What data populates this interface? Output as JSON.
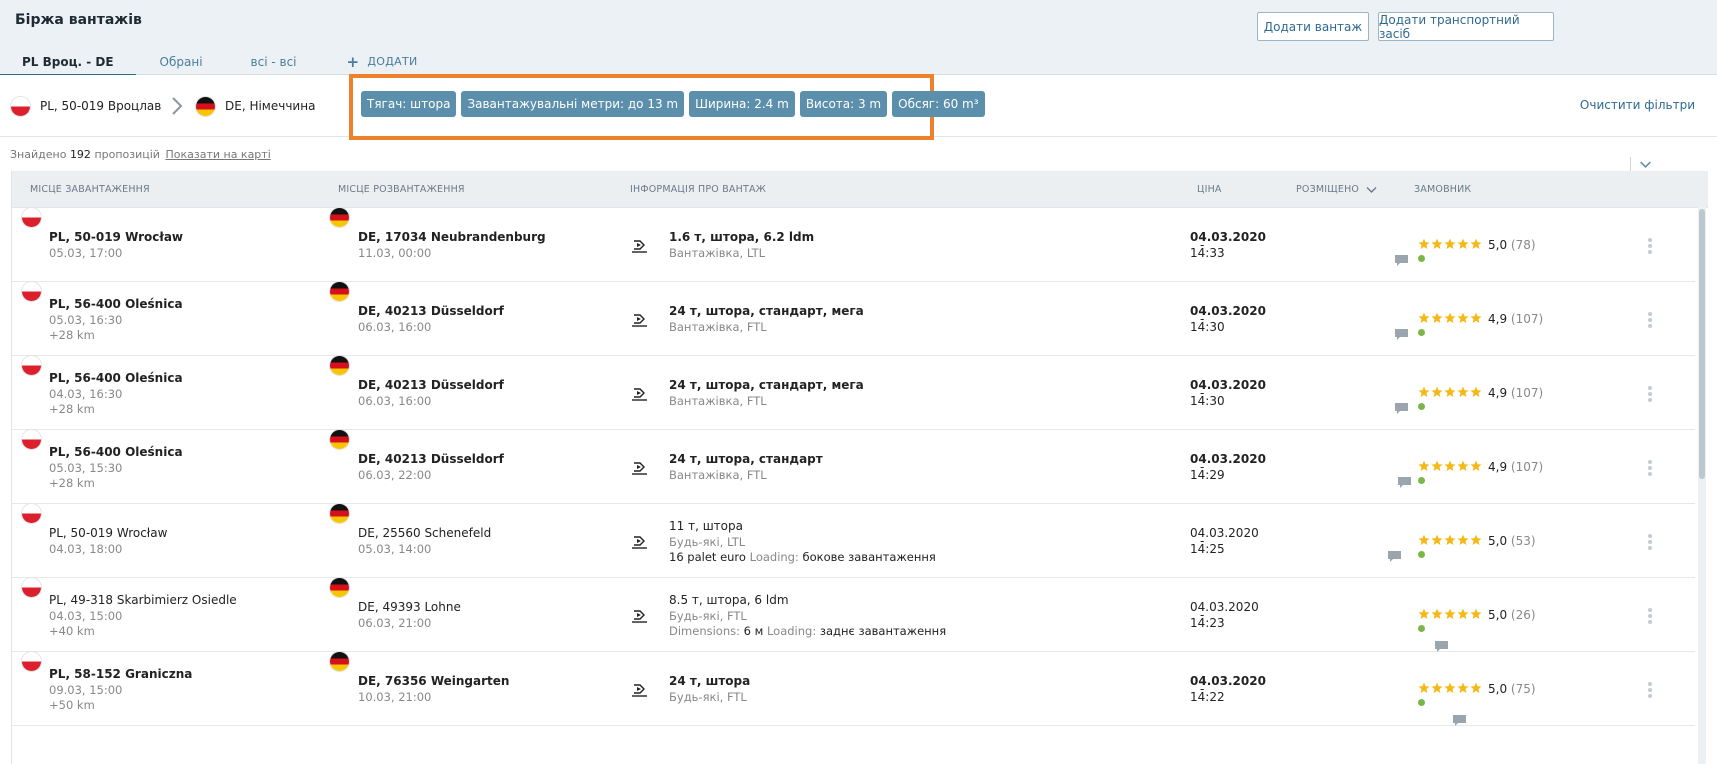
{
  "header": {
    "title": "Біржа вантажів",
    "add_freight_label": "Додати вантаж",
    "add_vehicle_label": "Додати транспортний засіб"
  },
  "tabs": [
    {
      "label": "PL Вроц. - DE",
      "active": true
    },
    {
      "label": "Обрані",
      "active": false
    },
    {
      "label": "всі - всі",
      "active": false
    }
  ],
  "add_tab_label": "ДОДАТИ",
  "filters": {
    "origin": "PL, 50-019 Вроцлав",
    "destination": "DE, Німеччина",
    "chips": [
      "Тягач: штора",
      "Завантажувальні метри: до 13 m",
      "Ширина: 2.4 m",
      "Висота: 3 m",
      "Обсяг: 60 m³"
    ],
    "clear_label": "Очистити фільтри"
  },
  "results": {
    "found_prefix": "Знайдено",
    "count": "192",
    "found_suffix": "пропозицій",
    "map_link": "Показати на карті"
  },
  "columns": {
    "loading": "МІСЦЕ ЗАВАНТАЖЕННЯ",
    "unloading": "МІСЦЕ РОЗВАНТАЖЕННЯ",
    "cargo": "ІНФОРМАЦІЯ ПРО ВАНТАЖ",
    "price": "ЦІНА",
    "posted": "РОЗМІЩЕНО",
    "customer": "ЗАМОВНИК"
  },
  "rows": [
    {
      "from_place": "PL, 50-019 Wrocław",
      "from_date": "05.03, 17:00",
      "from_extra": "",
      "to_place": "DE, 17034 Neubrandenburg",
      "to_date": "11.03, 00:00",
      "cargo_main": "1.6 т, штора, 6.2 ldm",
      "cargo_type": "Вантажівка, LTL",
      "cargo_extra_label": "",
      "cargo_extra": "",
      "cargo_extra_label2": "",
      "cargo_extra2": "",
      "price": "-",
      "posted_date": "04.03.2020",
      "posted_time": "14:33",
      "rating": "5,0",
      "reviews": "(78)",
      "bold": true
    },
    {
      "from_place": "PL, 56-400 Oleśnica",
      "from_date": "05.03, 16:30",
      "from_extra": "+28 km",
      "to_place": "DE, 40213 Düsseldorf",
      "to_date": "06.03, 16:00",
      "cargo_main": "24 т, штора, стандарт, мега",
      "cargo_type": "Вантажівка, FTL",
      "cargo_extra_label": "",
      "cargo_extra": "",
      "cargo_extra_label2": "",
      "cargo_extra2": "",
      "price": "-",
      "posted_date": "04.03.2020",
      "posted_time": "14:30",
      "rating": "4,9",
      "reviews": "(107)",
      "bold": true
    },
    {
      "from_place": "PL, 56-400 Oleśnica",
      "from_date": "04.03, 16:30",
      "from_extra": "+28 km",
      "to_place": "DE, 40213 Düsseldorf",
      "to_date": "06.03, 16:00",
      "cargo_main": "24 т, штора, стандарт, мега",
      "cargo_type": "Вантажівка, FTL",
      "cargo_extra_label": "",
      "cargo_extra": "",
      "cargo_extra_label2": "",
      "cargo_extra2": "",
      "price": "-",
      "posted_date": "04.03.2020",
      "posted_time": "14:30",
      "rating": "4,9",
      "reviews": "(107)",
      "bold": true
    },
    {
      "from_place": "PL, 56-400 Oleśnica",
      "from_date": "05.03, 15:30",
      "from_extra": "+28 km",
      "to_place": "DE, 40213 Düsseldorf",
      "to_date": "06.03, 22:00",
      "cargo_main": "24 т, штора, стандарт",
      "cargo_type": "Вантажівка, FTL",
      "cargo_extra_label": "",
      "cargo_extra": "",
      "cargo_extra_label2": "",
      "cargo_extra2": "",
      "price": "-",
      "posted_date": "04.03.2020",
      "posted_time": "14:29",
      "rating": "4,9",
      "reviews": "(107)",
      "bold": true
    },
    {
      "from_place": "PL, 50-019 Wrocław",
      "from_date": "04.03, 18:00",
      "from_extra": "",
      "to_place": "DE, 25560 Schenefeld",
      "to_date": "05.03, 14:00",
      "cargo_main": "11 т, штора",
      "cargo_type": "Будь-які, LTL",
      "cargo_extra_label": "16 palet euro",
      "cargo_extra": "",
      "cargo_extra_label2": "Loading:",
      "cargo_extra2": "бокове завантаження",
      "price": "-",
      "posted_date": "04.03.2020",
      "posted_time": "14:25",
      "rating": "5,0",
      "reviews": "(53)",
      "bold": false
    },
    {
      "from_place": "PL, 49-318 Skarbimierz Osiedle",
      "from_date": "04.03, 15:00",
      "from_extra": "+40 km",
      "to_place": "DE, 49393 Lohne",
      "to_date": "06.03, 21:00",
      "cargo_main": "8.5 т, штора, 6 ldm",
      "cargo_type": "Будь-які, FTL",
      "cargo_extra_label": "Dimensions:",
      "cargo_extra": "6 м",
      "cargo_extra_label2": "Loading:",
      "cargo_extra2": "заднє завантаження",
      "price": "-",
      "posted_date": "04.03.2020",
      "posted_time": "14:23",
      "rating": "5,0",
      "reviews": "(26)",
      "bold": false
    },
    {
      "from_place": "PL, 58-152 Graniczna",
      "from_date": "09.03, 15:00",
      "from_extra": "+50 km",
      "to_place": "DE, 76356 Weingarten",
      "to_date": "10.03, 21:00",
      "cargo_main": "24 т, штора",
      "cargo_type": "Будь-які, FTL",
      "cargo_extra_label": "",
      "cargo_extra": "",
      "cargo_extra_label2": "",
      "cargo_extra2": "",
      "price": "-",
      "posted_date": "04.03.2020",
      "posted_time": "14:22",
      "rating": "5,0",
      "reviews": "(75)",
      "bold": true
    }
  ],
  "colors": {
    "accent": "#2e6b8f",
    "chip": "#5b8fab",
    "highlight": "#f0812b",
    "star": "#f5b917",
    "online": "#7ab648"
  },
  "icons": {
    "flag_origin": "poland-flag-icon",
    "flag_destination": "germany-flag-icon",
    "route_arrow": "chevron-right-icon",
    "sort": "chevron-down-icon",
    "cargo": "truck-arrow-icon",
    "rating": "star-icon",
    "message": "chat-bubble-icon",
    "actions": "kebab-menu-icon"
  }
}
